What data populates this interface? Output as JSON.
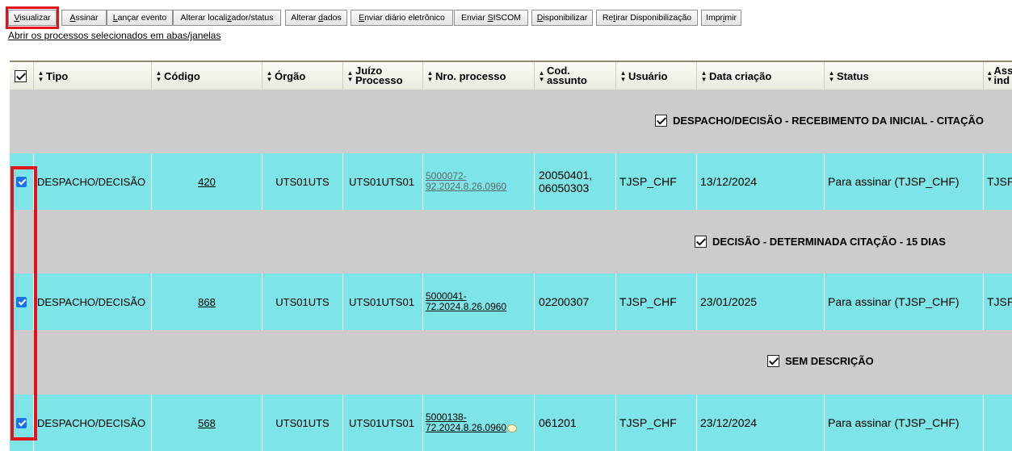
{
  "toolbar": {
    "buttons": [
      {
        "pre": "",
        "u": "V",
        "post": "isualizar"
      },
      {
        "pre": "",
        "u": "A",
        "post": "ssinar"
      },
      {
        "pre": "",
        "u": "L",
        "post": "ançar evento"
      },
      {
        "pre": "Alterar locali",
        "u": "z",
        "post": "ador/status"
      },
      {
        "pre": "Alterar ",
        "u": "d",
        "post": "ados"
      },
      {
        "pre": "",
        "u": "E",
        "post": "nviar diário eletrônico"
      },
      {
        "pre": "Enviar ",
        "u": "S",
        "post": "ISCOM"
      },
      {
        "pre": "",
        "u": "D",
        "post": "isponibilizar"
      },
      {
        "pre": "Re",
        "u": "t",
        "post": "irar Disponibilização"
      },
      {
        "pre": "Impr",
        "u": "i",
        "post": "mir"
      }
    ],
    "open_link": "Abrir os processos selecionados em abas/janelas"
  },
  "table": {
    "headers": {
      "tipo": "Tipo",
      "codigo": "Código",
      "orgao": "Órgão",
      "juizo_1": "Juízo",
      "juizo_2": "Processo",
      "nro": "Nro. processo",
      "cod_1": "Cod.",
      "cod_2": "assunto",
      "usuario": "Usuário",
      "data": "Data criação",
      "status": "Status",
      "ass_1": "Ass",
      "ass_2": "ind"
    },
    "groups": [
      {
        "label": "DESPACHO/DECISÃO - RECEBIMENTO DA INICIAL - CITAÇÃO",
        "checked": true
      },
      {
        "label": "DECISÃO - DETERMINADA CITAÇÃO - 15 DIAS",
        "checked": true
      },
      {
        "label": "SEM DESCRIÇÃO",
        "checked": true
      }
    ],
    "rows": [
      {
        "tipo": "DESPACHO/DECISÃO",
        "codigo": "420",
        "orgao": "UTS01UTS",
        "juizo": "UTS01UTS01",
        "proc_1": "5000072-",
        "proc_2": "92.2024.8.26.0960",
        "assunto_1": "20050401,",
        "assunto_2": "06050303",
        "usuario": "TJSP_CHF",
        "data": "13/12/2024",
        "status": "Para assinar (TJSP_CHF)",
        "assinado": "TJSP"
      },
      {
        "tipo": "DESPACHO/DECISÃO",
        "codigo": "868",
        "orgao": "UTS01UTS",
        "juizo": "UTS01UTS01",
        "proc_1": "5000041-",
        "proc_2": "72.2024.8.26.0960",
        "assunto_1": "02200307",
        "assunto_2": "",
        "usuario": "TJSP_CHF",
        "data": "23/01/2025",
        "status": "Para assinar (TJSP_CHF)",
        "assinado": "TJSP"
      },
      {
        "tipo": "DESPACHO/DECISÃO",
        "codigo": "568",
        "orgao": "UTS01UTS",
        "juizo": "UTS01UTS01",
        "proc_1": "5000138-",
        "proc_2": "72.2024.8.26.0960",
        "assunto_1": "061201",
        "assunto_2": "",
        "usuario": "TJSP_CHF",
        "data": "23/12/2024",
        "status": "Para assinar (TJSP_CHF)",
        "assinado": ""
      }
    ]
  },
  "colors": {
    "row_bg": "#7de4e7",
    "group_bg": "#cccccc",
    "highlight": "#e1141d"
  }
}
